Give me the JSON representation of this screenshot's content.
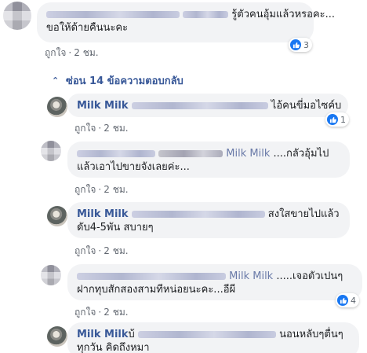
{
  "comments": [
    {
      "text_line1": "รู้ตัวคนอุ้มแล้วหรอคะ...",
      "text_line2": "ขอให้ด้ายคืนนะคะ",
      "like_label": "ถูกใจ",
      "time": "2 ชม.",
      "reaction_count": "3"
    }
  ],
  "replies_toggle": {
    "label": "ซ่อน 14 ข้อความตอบกลับ"
  },
  "replies": [
    {
      "author": "Milk Milk",
      "text_line1": "ไอ้คนขี่มอไซค์บ",
      "like_label": "ถูกใจ",
      "time": "2 ชม.",
      "reaction_count": "1"
    },
    {
      "mention": "Milk Milk",
      "text_line1": "....กลัวอุ้มไป",
      "text_line2": "แล้วเอาไปขายจังเลยค่ะ...",
      "like_label": "ถูกใจ",
      "time": "2 ชม."
    },
    {
      "author": "Milk Milk",
      "text_line1": "สงใสขายไปแล้ว",
      "text_line2": "ดับ4-5พัน สบายๆ",
      "like_label": "ถูกใจ",
      "time": "2 ชม."
    },
    {
      "mention": "Milk Milk",
      "text_line1": ".....เจอตัวเปนๆ",
      "text_line2": "ฝากทุบสักสองสามทีหน่อยนะคะ...อีผี",
      "like_label": "ถูกใจ",
      "time": "2 ชม.",
      "reaction_count": "4"
    },
    {
      "author": "Milk Milk",
      "author_suffix": "บ้",
      "text_line1": "นอนหลับๆตื่นๆ",
      "text_line2": "ทุกวัน คิดถึงหมา"
    }
  ]
}
